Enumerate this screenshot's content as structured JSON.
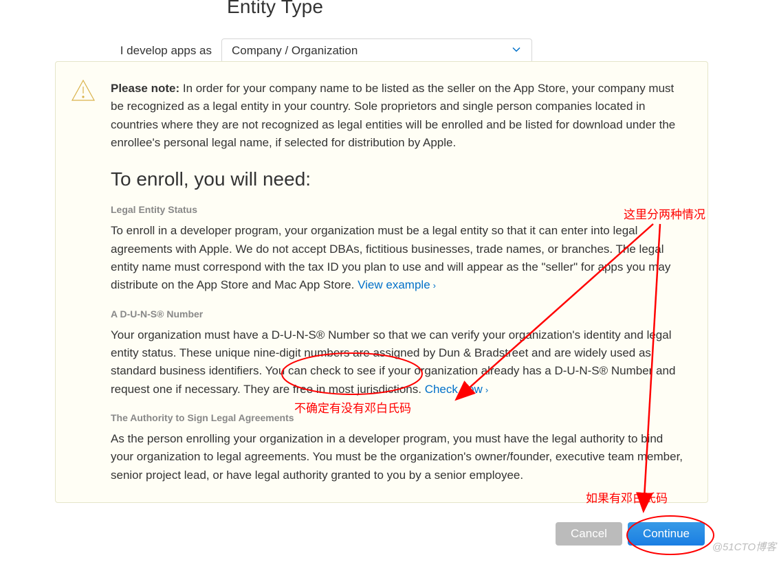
{
  "header": {
    "title": "Entity Type",
    "label": "I develop apps as",
    "select_value": "Company / Organization"
  },
  "notice": {
    "please_note_bold": "Please note:",
    "please_note_body": " In order for your company name to be listed as the seller on the App Store, your company must be recognized as a legal entity in your country. Sole proprietors and single person companies located in countries where they are not recognized as legal entities will be enrolled and be listed for download under the enrollee's personal legal name, if selected for distribution by Apple.",
    "heading": "To enroll, you will need:",
    "s1_title": "Legal Entity Status",
    "s1_body": "To enroll in a developer program, your organization must be a legal entity so that it can enter into legal agreements with Apple. We do not accept DBAs, fictitious businesses, trade names, or branches. The legal entity name must correspond with the tax ID you plan to use and will appear as the \"seller\" for apps you may distribute on the App Store and Mac App Store. ",
    "s1_link": "View example",
    "s2_title": "A D-U-N-S® Number",
    "s2_body": "Your organization must have a D-U-N-S® Number so that we can verify your organization's identity and legal entity status. These unique nine-digit numbers are assigned by Dun & Bradstreet and are widely used as standard business identifiers. You can check to see if your organization already has a D-U-N-S® Number and request one if necessary. They are free in most jurisdictions. ",
    "s2_link": "Check now",
    "s3_title": "The Authority to Sign Legal Agreements",
    "s3_body": "As the person enrolling your organization in a developer program, you must have the legal authority to bind your organization to legal agreements. You must be the organization's owner/founder, executive team member, senior project lead, or have legal authority granted to you by a senior employee."
  },
  "buttons": {
    "cancel": "Cancel",
    "continue": "Continue"
  },
  "annotations": {
    "two_cases": "这里分两种情况",
    "unsure_duns": "不确定有没有邓白氏码",
    "have_duns": "如果有邓白氏码"
  },
  "watermark": "@51CTO博客"
}
